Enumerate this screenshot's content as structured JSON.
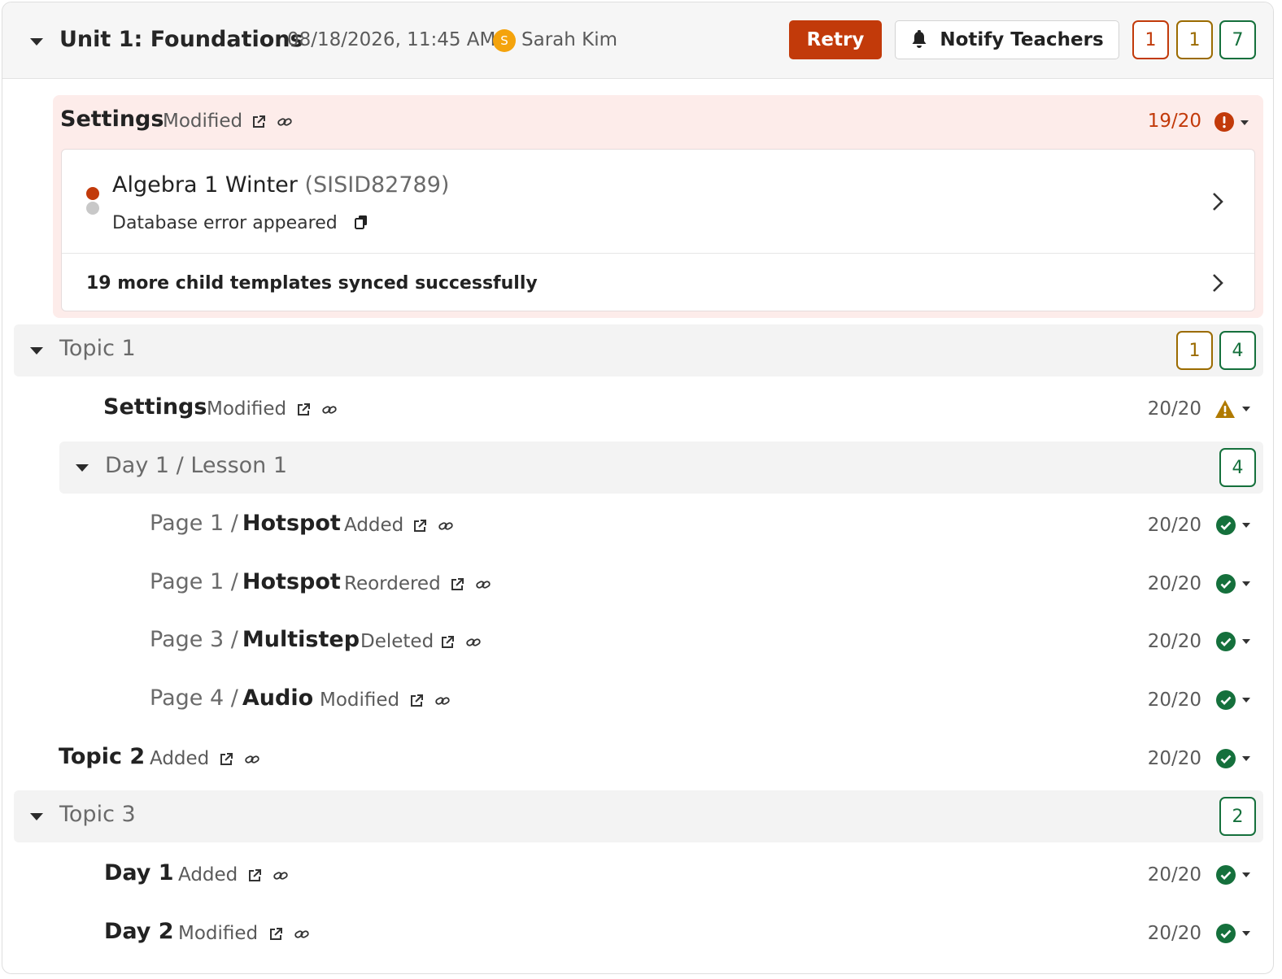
{
  "header": {
    "title": "Unit 1: Foundations",
    "datetime": "08/18/2026, 11:45 AM",
    "avatar_initial": "S",
    "user_name": "Sarah Kim",
    "retry_label": "Retry",
    "notify_label": "Notify Teachers",
    "counts": {
      "error": "1",
      "warning": "1",
      "success": "7"
    }
  },
  "colors": {
    "error": "#c23a0a",
    "warning": "#9b6b00",
    "success": "#15703c",
    "avatar": "#f4a30c"
  },
  "unit_settings": {
    "title": "Settings",
    "status": "Modified",
    "score": "19/20",
    "status_icon": "error-icon",
    "error_item": {
      "class_name": "Algebra 1 Winter",
      "sis_id": "(SISID82789)",
      "message": "Database error appeared"
    },
    "more_text": "19 more child templates synced successfully"
  },
  "topic1": {
    "title": "Topic 1",
    "counts": {
      "warning": "1",
      "success": "4"
    },
    "settings": {
      "title": "Settings",
      "status": "Modified",
      "score": "20/20",
      "status_icon": "warning-icon"
    },
    "day1": {
      "title": "Day 1 / Lesson 1",
      "counts": {
        "success": "4"
      },
      "pages": [
        {
          "prefix": "Page 1 /",
          "name": "Hotspot",
          "status": "Added",
          "score": "20/20"
        },
        {
          "prefix": "Page 1 /",
          "name": "Hotspot",
          "status": "Reordered",
          "score": "20/20"
        },
        {
          "prefix": "Page 3 /",
          "name": "Multistep",
          "status": "Deleted",
          "score": "20/20"
        },
        {
          "prefix": "Page 4 /",
          "name": "Audio",
          "status": "Modified",
          "score": "20/20"
        }
      ]
    }
  },
  "topic2": {
    "title": "Topic 2",
    "status": "Added",
    "score": "20/20"
  },
  "topic3": {
    "title": "Topic 3",
    "counts": {
      "success": "2"
    },
    "days": [
      {
        "name": "Day 1",
        "status": "Added",
        "score": "20/20"
      },
      {
        "name": "Day 2",
        "status": "Modified",
        "score": "20/20"
      }
    ]
  }
}
